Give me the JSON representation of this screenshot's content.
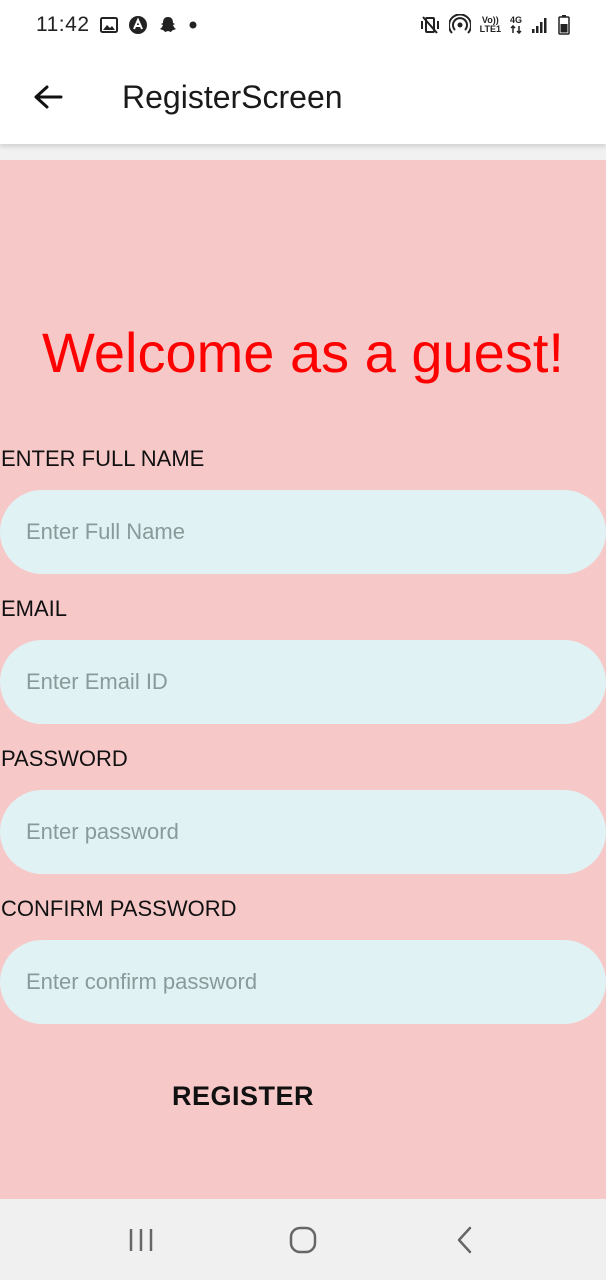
{
  "status_bar": {
    "time": "11:42",
    "left_icons": [
      "image-icon",
      "app-a-icon",
      "snapchat-icon",
      "dot-icon"
    ],
    "right_icons": [
      "vibrate-mute-icon",
      "hotspot-icon",
      "volte-icon",
      "4g-icon",
      "signal-icon",
      "battery-icon"
    ],
    "volte_text_top": "Vo))",
    "volte_text_bottom": "LTE1",
    "net_text": "4G"
  },
  "app_bar": {
    "title": "RegisterScreen",
    "back_icon": "arrow-left-icon"
  },
  "main": {
    "welcome": "Welcome as a guest!",
    "fields": [
      {
        "label": "ENTER FULL NAME",
        "placeholder": "Enter Full Name",
        "value": ""
      },
      {
        "label": "EMAIL",
        "placeholder": "Enter Email ID",
        "value": ""
      },
      {
        "label": "PASSWORD",
        "placeholder": "Enter password",
        "value": ""
      },
      {
        "label": "CONFIRM PASSWORD",
        "placeholder": "Enter confirm password",
        "value": ""
      }
    ],
    "register_label": "REGISTER"
  },
  "nav_bar": {
    "items": [
      "recent-apps-icon",
      "home-icon",
      "back-icon"
    ]
  },
  "colors": {
    "content_background": "#f7c8c8",
    "input_background": "#e0f2f3",
    "welcome_text": "#ff0000",
    "nav_background": "#f0f0f0"
  }
}
